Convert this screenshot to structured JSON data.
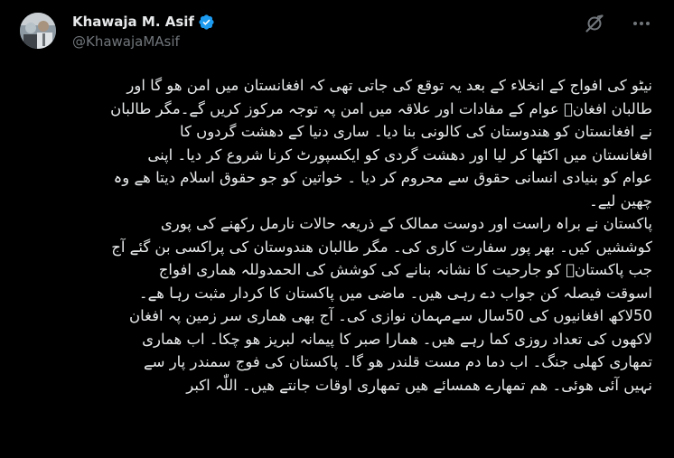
{
  "author": {
    "display_name": "Khawaja M. Asif",
    "handle": "@KhawajaMAsif"
  },
  "icons": {
    "verified": "verified-badge-icon",
    "grok": "grok-icon",
    "more": "more-options-icon",
    "verified_color": "#1d9bf0",
    "muted_color": "#71767b"
  },
  "tweet": {
    "lines": [
      "نیٹو کی افواج کے انخلاء کے بعد یہ توقع کی جاتی تھی کہ افغانستان میں امن ھو گا اور",
      "طالبان افغانؐ عوام کے مفادات اور علاقہ میں امن پہ توجہ مرکوز کریں گے۔مگر طالبان",
      "نے افغانستان کو ھندوستان کی کالونی بنا دیا۔ ساری دنیا کے دھشت گردوں کا",
      "افغانستان میں اکٹھا کر لیا اور دھشت گردی کو ایکسپورٹ کرنا شروع کر دیا۔ اپنی",
      "عوام کو بنیادی انسانی حقوق سے محروم کر دیا ۔ خواتین کو جو حقوق اسلام دیتا ھے وہ",
      "چھین لیے۔",
      "پاکستان نے براہ راست اور دوست ممالک کے ذریعہ حالات نارمل رکھنے کی پوری",
      "کوششیں کیں۔ بھر پور سفارت کاری کی۔ مگر طالبان ھندوستان کی پراکسی بن گئے آج",
      "جب پاکستانؐ کو جارحیت کا نشانہ بنانے کی کوشش کی الحمدوللہ ھماری افواج",
      "اسوقت فیصلہ کن جواب دے رہی ھیں۔ ماضی میں پاکستان کا کردار مثبت رہا ھے۔",
      "50لاکھ افغانیوں کی 50سال سےمہمان نوازی کی۔ آج بھی ھماری سر زمین پہ افغان",
      "لاکھوں کی تعداد روزی کما رہے ھیں۔ ھمارا صبر کا پیمانہ لبریز ھو چکا۔ اب ھماری",
      "تمھاری کھلی جنگ۔ اب دما دم مست قلندر ھو گا۔ پاکستان کی فوج سمندر پار سے",
      "نہیں آئی ھوئی۔ ھم تمھارے ھمسائے ھیں تمھاری اوقات جانتے ھیں۔ اللّٰہ اکبر"
    ]
  }
}
